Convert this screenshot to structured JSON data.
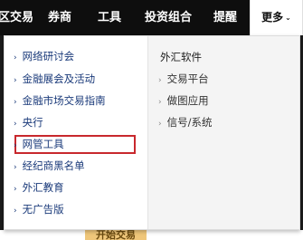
{
  "nav": {
    "items": [
      "区交易",
      "券商",
      "工具",
      "投资组合",
      "提醒"
    ],
    "more_label": "更多",
    "more_icon": "chevron-down-icon"
  },
  "dropdown": {
    "left_items": [
      "网络研讨会",
      "金融展会及活动",
      "金融市场交易指南",
      "央行",
      "网管工具",
      "经纪商黑名单",
      "外汇教育",
      "无广告版"
    ],
    "highlighted_item": "网管工具",
    "right_heading": "外汇软件",
    "right_items": [
      "交易平台",
      "做图应用",
      "信号/系统"
    ],
    "arrow_glyph": "›"
  },
  "bottom_button_label": "开始交易",
  "colors": {
    "nav_bg": "#0e0e0e",
    "link": "#1a3a7a",
    "highlight_border": "#c8282d",
    "button": "#efc67a"
  }
}
